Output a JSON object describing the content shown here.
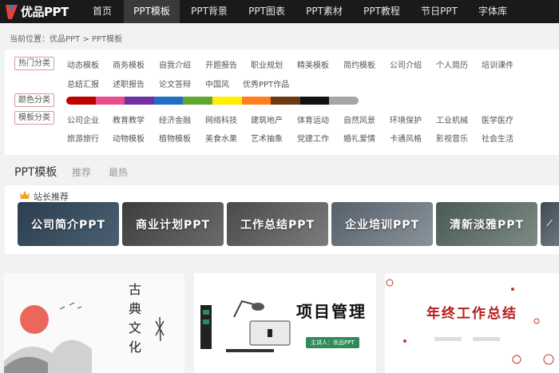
{
  "nav": {
    "logo_text": "优品PPT",
    "items": [
      {
        "label": "首页",
        "active": false
      },
      {
        "label": "PPT模板",
        "active": true
      },
      {
        "label": "PPT背景",
        "active": false
      },
      {
        "label": "PPT图表",
        "active": false
      },
      {
        "label": "PPT素材",
        "active": false
      },
      {
        "label": "PPT教程",
        "active": false
      },
      {
        "label": "节日PPT",
        "active": false
      },
      {
        "label": "字体库",
        "active": false
      }
    ]
  },
  "breadcrumb": "当前位置：优品PPT > PPT模板",
  "filters": {
    "hot_label": "热门分类",
    "hot_row1": [
      "动态模板",
      "商务模板",
      "自我介绍",
      "开题报告",
      "职业规划",
      "精美模板",
      "简约模板",
      "公司介绍",
      "个人简历",
      "培训课件"
    ],
    "hot_row2": [
      "总结汇报",
      "述职报告",
      "论文答辩",
      "中国风",
      "优秀PPT作品"
    ],
    "color_label": "颜色分类",
    "colors": [
      "#c00000",
      "#e84c8b",
      "#7030a0",
      "#1f6fc5",
      "#5fa72e",
      "#ffee00",
      "#ff7f1a",
      "#6b3a12",
      "#111111",
      "#a6a6a6"
    ],
    "template_label": "模板分类",
    "template_row1": [
      "公司企业",
      "教育教学",
      "经济金融",
      "网络科技",
      "建筑地产",
      "体育运动",
      "自然风景",
      "环境保护",
      "工业机械",
      "医学医疗"
    ],
    "template_row2": [
      "旅游旅行",
      "动物模板",
      "植物模板",
      "美食水果",
      "艺术抽象",
      "党建工作",
      "婚礼爱情",
      "卡通风格",
      "影视音乐",
      "社会生活"
    ]
  },
  "tabs": [
    {
      "label": "PPT模板",
      "active": true
    },
    {
      "label": "推荐",
      "active": false
    },
    {
      "label": "最热",
      "active": false
    }
  ],
  "featured": {
    "title": "站长推荐",
    "banners": [
      "公司简介PPT",
      "商业计划PPT",
      "工作总结PPT",
      "企业培训PPT",
      "清新淡雅PPT"
    ]
  },
  "cards": {
    "card1": {
      "title": "古典文化"
    },
    "card2": {
      "title": "项目管理",
      "presenter": "主讲人：优品PPT"
    },
    "card3": {
      "title": "年终工作总结"
    }
  }
}
